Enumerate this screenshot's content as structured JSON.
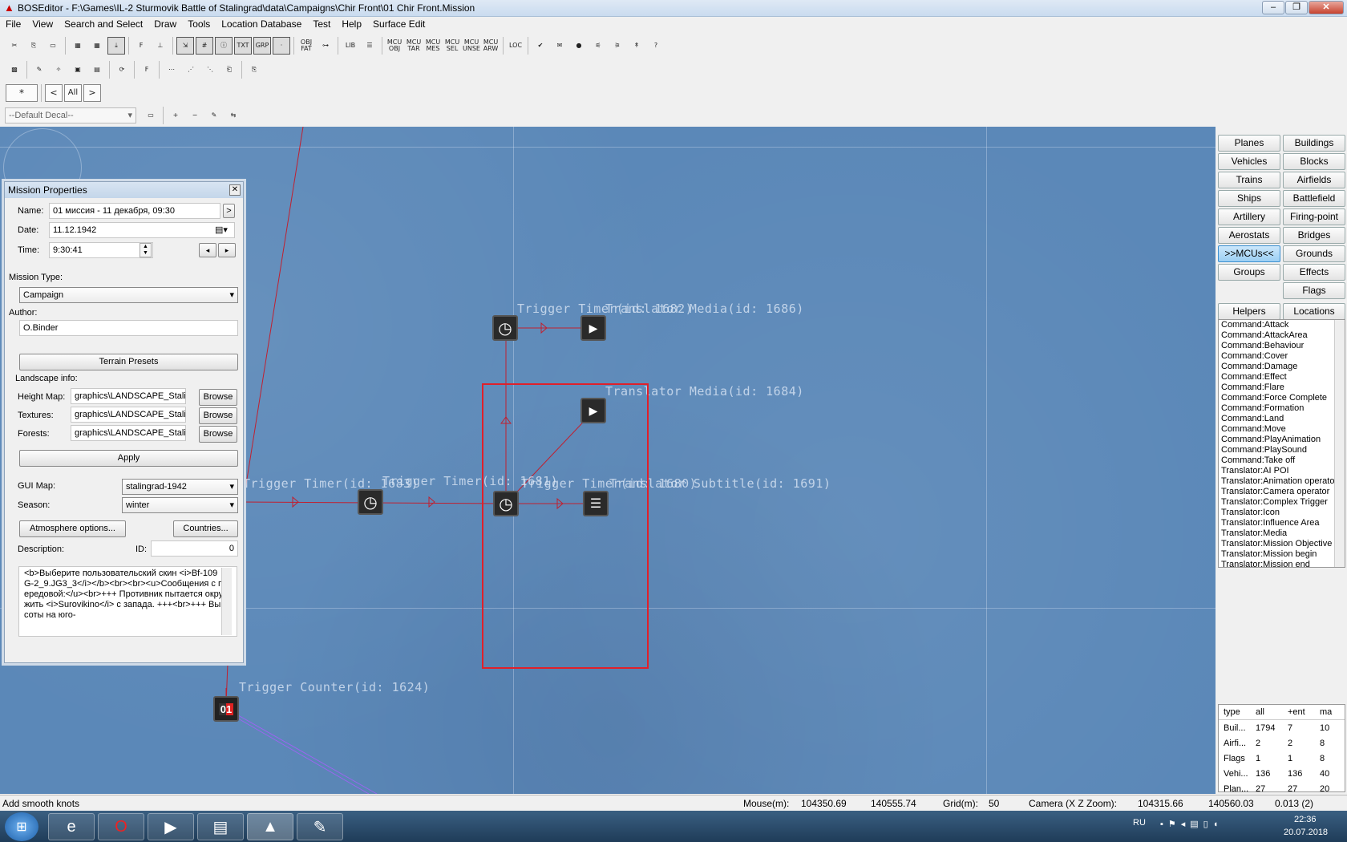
{
  "window": {
    "title": "BOSEditor - F:\\Games\\IL-2 Sturmovik Battle of Stalingrad\\data\\Campaigns\\Chir Front\\01 Chir Front.Mission",
    "minimize": "–",
    "maximize": "❐",
    "close": "✕"
  },
  "menu": [
    "File",
    "View",
    "Search and Select",
    "Draw",
    "Tools",
    "Location Database",
    "Test",
    "Help",
    "Surface Edit"
  ],
  "toolbar1": [
    {
      "label": "✂",
      "icon": "cut-icon"
    },
    {
      "label": "⎘",
      "icon": "copy-icon"
    },
    {
      "label": "▭",
      "icon": "ruler-icon"
    },
    {
      "label": "▦",
      "icon": "map-green-icon"
    },
    {
      "label": "▦",
      "icon": "map-color-icon"
    },
    {
      "label": "⤓",
      "icon": "download-icon"
    },
    {
      "label": "F",
      "icon": "f-icon"
    },
    {
      "label": "⊥",
      "icon": "ground-icon"
    },
    {
      "label": "⇲",
      "icon": "xz-icon"
    },
    {
      "label": "#",
      "icon": "grid-icon"
    },
    {
      "label": "ⓘ",
      "icon": "info-icon"
    },
    {
      "label": "TXT",
      "icon": "txt-icon"
    },
    {
      "label": "GRP",
      "icon": "grp-icon"
    },
    {
      "label": "·",
      "icon": "dot-icon"
    },
    {
      "label": "OBJ FAT",
      "icon": "obj-fat-icon"
    },
    {
      "label": "⊶",
      "icon": "link-icon"
    },
    {
      "label": "LIB",
      "icon": "lib-icon"
    },
    {
      "label": "☰",
      "icon": "list-icon"
    },
    {
      "label": "MCU OBJ",
      "icon": "mcu-obj-icon"
    },
    {
      "label": "MCU TAR",
      "icon": "mcu-tar-icon"
    },
    {
      "label": "MCU MES",
      "icon": "mcu-mes-icon"
    },
    {
      "label": "MCU SEL",
      "icon": "mcu-sel-icon"
    },
    {
      "label": "MCU UNSE",
      "icon": "mcu-unse-icon"
    },
    {
      "label": "MCU ARW",
      "icon": "mcu-arw-icon"
    },
    {
      "label": "LOC",
      "icon": "loc-icon"
    },
    {
      "label": "✔",
      "icon": "check-icon"
    },
    {
      "label": "✉",
      "icon": "mail-icon"
    },
    {
      "label": "●",
      "icon": "green-dot-icon"
    },
    {
      "label": "⚟",
      "icon": "level-icon"
    },
    {
      "label": "⚞",
      "icon": "level2-icon"
    },
    {
      "label": "↟",
      "icon": "arrow-up-icon"
    },
    {
      "label": "?",
      "icon": "help-icon"
    }
  ],
  "toolbar2": [
    {
      "label": "▩",
      "icon": "checker-icon"
    },
    {
      "label": "✎",
      "icon": "draw-icon"
    },
    {
      "label": "✧",
      "icon": "spline-icon"
    },
    {
      "label": "▣",
      "icon": "image-icon"
    },
    {
      "label": "▤",
      "icon": "picture-icon"
    },
    {
      "label": "⟳",
      "icon": "rotate-icon"
    },
    {
      "label": "F",
      "icon": "f2-icon"
    },
    {
      "label": "⋯",
      "icon": "knots-icon"
    },
    {
      "label": "⋰",
      "icon": "knots2-icon"
    },
    {
      "label": "⋱",
      "icon": "knots3-icon"
    },
    {
      "label": "⎗",
      "icon": "export-icon"
    },
    {
      "label": "⎘",
      "icon": "import-icon"
    }
  ],
  "toolbar3": {
    "star": "*",
    "prev": "<",
    "all": "All",
    "next": ">"
  },
  "decal": {
    "value": "--Default Decal--"
  },
  "toolbar4": [
    {
      "label": "▭",
      "icon": "decal-icon"
    },
    {
      "label": "+",
      "icon": "add-icon"
    },
    {
      "label": "−",
      "icon": "remove-icon"
    },
    {
      "label": "✎",
      "icon": "pencil-icon"
    },
    {
      "label": "⇆",
      "icon": "swap-icon"
    }
  ],
  "props": {
    "title": "Mission Properties",
    "name_label": "Name:",
    "name_value": "01 миссия - 11 декабря, 09:30",
    "name_btn": ">",
    "date_label": "Date:",
    "date_value": "11.12.1942",
    "time_label": "Time:",
    "time_value": "9:30:41",
    "mission_type_label": "Mission Type:",
    "mission_type_value": "Campaign",
    "author_label": "Author:",
    "author_value": "O.Binder",
    "terrain_presets": "Terrain Presets",
    "landscape_label": "Landscape info:",
    "height_label": "Height Map:",
    "height_value": "graphics\\LANDSCAPE_Stalin",
    "textures_label": "Textures:",
    "textures_value": "graphics\\LANDSCAPE_Stalin",
    "forests_label": "Forests:",
    "forests_value": "graphics\\LANDSCAPE_Stalin",
    "browse": "Browse",
    "apply": "Apply",
    "gui_label": "GUI Map:",
    "gui_value": "stalingrad-1942",
    "season_label": "Season:",
    "season_value": "winter",
    "atmosphere": "Atmosphere options...",
    "countries": "Countries...",
    "desc_label": "Description:",
    "id_label": "ID:",
    "id_value": "0",
    "desc_text": "<b>Выберите пользовательский скин <i>Bf-109G-2_9.JG3_3</i></b><br><br><u>Сообщения с передовой:</u><br>+++ Противник пытается окружить <i>Surovikino</i> с запада. +++<br>+++ Высоты на юго-"
  },
  "map": {
    "labels": [
      {
        "text": "Trigger Timer(id: 1682)",
        "key": "l1"
      },
      {
        "text": "Translator Media(id: 1686)",
        "key": "l2"
      },
      {
        "text": "Translator Media(id: 1684)",
        "key": "l3"
      },
      {
        "text": "Trigger Timer(id: 1683)",
        "key": "l4"
      },
      {
        "text": "Trigger Timer(id: 1681)",
        "key": "l5"
      },
      {
        "text": "Trigger Timer(id: 1680)",
        "key": "l6"
      },
      {
        "text": "Translator Subtitle(id: 1691)",
        "key": "l7"
      },
      {
        "text": "Trigger Counter(id: 1624)",
        "key": "l8"
      }
    ],
    "counter_text": "01"
  },
  "right": {
    "buttons": [
      "Planes",
      "Buildings",
      "Vehicles",
      "Blocks",
      "Trains",
      "Airfields",
      "Ships",
      "Battlefield",
      "Artillery",
      "Firing-point",
      "Aerostats",
      "Bridges",
      ">>MCUs<<",
      "Grounds",
      "Groups",
      "Effects",
      "Flags"
    ],
    "helpers": "Helpers",
    "locations": "Locations",
    "list": [
      "Command:Attack",
      "Command:AttackArea",
      "Command:Behaviour",
      "Command:Cover",
      "Command:Damage",
      "Command:Effect",
      "Command:Flare",
      "Command:Force Complete",
      "Command:Formation",
      "Command:Land",
      "Command:Move",
      "Command:PlayAnimation",
      "Command:PlaySound",
      "Command:Take off",
      "Translator:AI POI",
      "Translator:Animation operato",
      "Translator:Camera operator",
      "Translator:Complex Trigger",
      "Translator:Icon",
      "Translator:Influence Area",
      "Translator:Media",
      "Translator:Mission Objective",
      "Translator:Mission begin",
      "Translator:Mission end"
    ],
    "stats_header": [
      "type",
      "all",
      "+ent",
      "ma"
    ],
    "stats": [
      [
        "Buil...",
        "1794",
        "7",
        "10"
      ],
      [
        "Airfi...",
        "2",
        "2",
        "8"
      ],
      [
        "Flags",
        "1",
        "1",
        "8"
      ],
      [
        "Vehi...",
        "136",
        "136",
        "40"
      ],
      [
        "Plan...",
        "27",
        "27",
        "20"
      ]
    ]
  },
  "status": {
    "hint": "Add smooth knots",
    "mouse_label": "Mouse(m):",
    "mouse_x": "104350.69",
    "mouse_z": "140555.74",
    "grid_label": "Grid(m):",
    "grid_value": "50",
    "camera_label": "Camera (X Z Zoom):",
    "cam_x": "104315.66",
    "cam_z": "140560.03",
    "cam_zoom": "0.013 (2)"
  },
  "taskbar": {
    "lang": "RU",
    "time": "22:36",
    "date": "20.07.2018"
  }
}
